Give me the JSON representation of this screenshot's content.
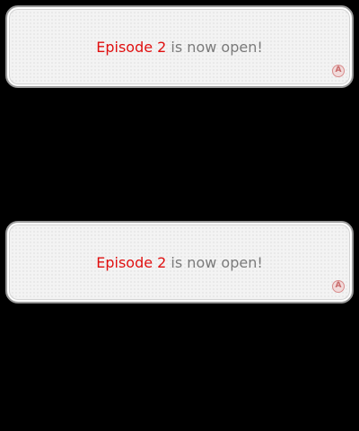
{
  "top_screen": {
    "message_highlight": "Episode 2",
    "message_rest": " is now open!",
    "button_glyph": "A"
  },
  "bottom_screen": {
    "message_highlight": "Episode 2",
    "message_rest": " is now open!",
    "button_glyph": "A"
  },
  "colors": {
    "background": "#000000",
    "highlight": "#e01010",
    "text": "#7a7a7a",
    "a_button": "#d88c8c"
  }
}
